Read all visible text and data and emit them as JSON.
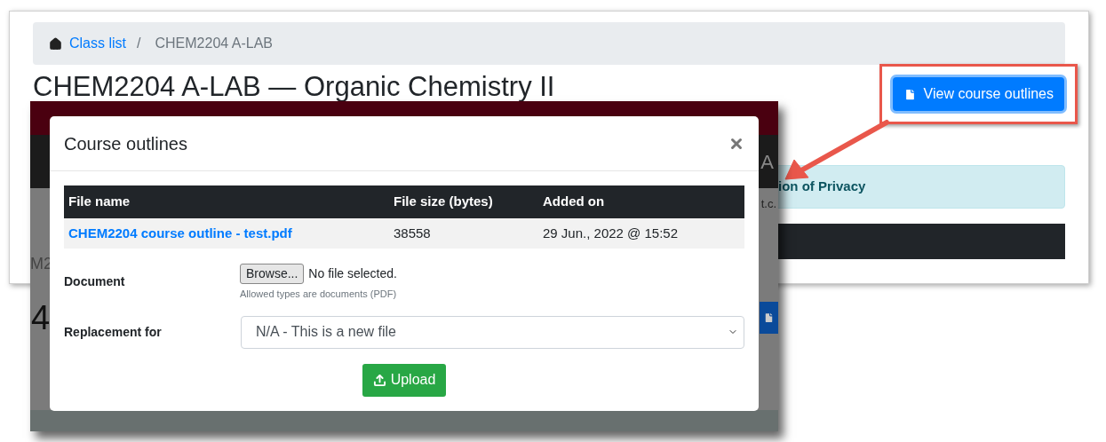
{
  "page": {
    "breadcrumb": [
      {
        "label": "Class list",
        "kind": "link"
      },
      {
        "label": "/",
        "kind": "separator"
      },
      {
        "label": "CHEM2204 A-LAB",
        "kind": "current"
      }
    ],
    "title": "CHEM2204 A-LAB — Organic Chemistry II",
    "view_button": "View course outlines",
    "notice": "ion of Privacy"
  },
  "screenshot": {
    "left_fragments": [
      "M2",
      "4"
    ],
    "right_fragments": [
      "A",
      "t.c."
    ]
  },
  "modal": {
    "title": "Course outlines",
    "table": {
      "columns": [
        "File name",
        "File size (bytes)",
        "Added on"
      ],
      "rows": [
        [
          "CHEM2204 course outline - test.pdf",
          "38558",
          "29 Jun., 2022 @ 15:52"
        ]
      ]
    },
    "document": {
      "label": "Document",
      "browse": "Browse...",
      "status": "No file selected.",
      "hint": "Allowed types are documents (PDF)"
    },
    "replacement": {
      "label": "Replacement for",
      "value": "N/A - This is a new file"
    },
    "upload": "Upload"
  }
}
